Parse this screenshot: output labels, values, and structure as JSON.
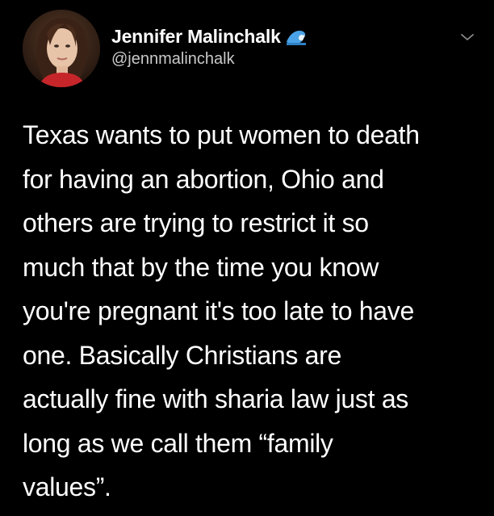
{
  "tweet": {
    "author": {
      "display_name": "Jennifer Malinchalk",
      "handle": "@jennmalinchalk",
      "name_emoji_icon": "water-wave-icon",
      "avatar_icon": "profile-photo"
    },
    "menu_icon": "chevron-down-icon",
    "text": "Texas wants to put women to death\nfor having an abortion, Ohio and\nothers are trying to restrict it so\nmuch that by the time you know\nyou're pregnant it's too late to have\none. Basically Christians are\nactually fine with sharia law just as\nlong as we call them “family\nvalues”.",
    "colors": {
      "background": "#000000",
      "text": "#ffffff",
      "handle": "#c9c9c9",
      "chevron": "#8a8a8a"
    }
  }
}
